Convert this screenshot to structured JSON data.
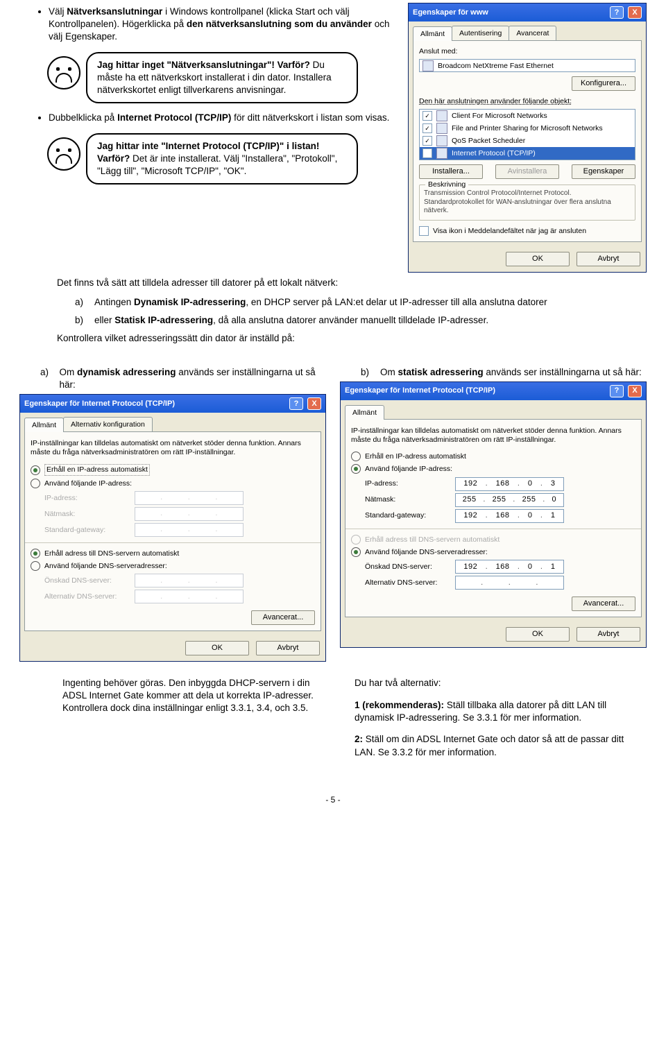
{
  "bullet1": {
    "pre": "Välj ",
    "b": "Nätverksanslutningar",
    "post": " i Windows kontrollpanel (klicka Start och välj Kontrollpanelen). Högerklicka på ",
    "b2": "den nätverksanslutning som du använder",
    "post2": " och välj Egenskaper."
  },
  "callout1": {
    "title": "Jag hittar inget \"Nätverksanslutningar\"! Varför?",
    "body": " Du måste ha ett nätverkskort installerat i din dator. Installera nätverkskortet enligt tillverkarens anvisningar."
  },
  "bullet2": {
    "pre": "Dubbelklicka på ",
    "b": "Internet Protocol (TCP/IP)",
    "post": " för ditt nätverkskort i listan som visas."
  },
  "callout2": {
    "title": "Jag hittar inte \"Internet Protocol (TCP/IP)\" i listan! Varför?",
    "body": " Det är inte installerat. Välj \"Installera\", \"Protokoll\", \"Lägg till\", \"Microsoft TCP/IP\", \"OK\"."
  },
  "win1": {
    "title": "Egenskaper för www",
    "help": "?",
    "close": "X",
    "tabs": [
      "Allmänt",
      "Autentisering",
      "Avancerat"
    ],
    "connect_label": "Anslut med:",
    "adapter": "Broadcom NetXtreme Fast Ethernet",
    "configure": "Konfigurera...",
    "uses_label": "Den här anslutningen använder följande objekt:",
    "items": [
      {
        "chk": true,
        "label": "Client For Microsoft Networks"
      },
      {
        "chk": true,
        "label": "File and Printer Sharing for Microsoft Networks"
      },
      {
        "chk": true,
        "label": "QoS Packet Scheduler"
      },
      {
        "chk": true,
        "label": "Internet Protocol (TCP/IP)",
        "sel": true
      }
    ],
    "btn_install": "Installera...",
    "btn_uninstall": "Avinstallera",
    "btn_props": "Egenskaper",
    "desc_title": "Beskrivning",
    "desc": "Transmission Control Protocol/Internet Protocol. Standardprotokollet för WAN-anslutningar över flera anslutna nätverk.",
    "notify": "Visa ikon i Meddelandefältet när jag är ansluten",
    "ok": "OK",
    "cancel": "Avbryt"
  },
  "midtext": {
    "intro": "Det finns två sätt att tilldela adresser till datorer på ett lokalt nätverk:",
    "a_pre": "Antingen ",
    "a_b": "Dynamisk IP-adressering",
    "a_post": ", en DHCP server på LAN:et delar ut IP-adresser till alla anslutna datorer",
    "b_pre": "eller ",
    "b_b": "Statisk IP-adressering",
    "b_post": ", då alla anslutna datorer använder manuellt tilldelade IP-adresser.",
    "check": "Kontrollera vilket adresseringssätt din dator är inställd på:",
    "dyn_pre": "Om ",
    "dyn_b": "dynamisk adressering",
    "dyn_post": " används ser inställningarna ut så här:",
    "stat_pre": "Om ",
    "stat_b": "statisk adressering",
    "stat_post": " används ser inställningarna ut så här:"
  },
  "tcp": {
    "title": "Egenskaper för Internet Protocol (TCP/IP)",
    "tabs_a": [
      "Allmänt",
      "Alternativ konfiguration"
    ],
    "tabs_b": [
      "Allmänt"
    ],
    "intro": "IP-inställningar kan tilldelas automatiskt om nätverket stöder denna funktion. Annars måste du fråga nätverksadministratören om rätt IP-inställningar.",
    "r_auto_ip": "Erhåll en IP-adress automatiskt",
    "r_man_ip": "Använd följande IP-adress:",
    "f_ip": "IP-adress:",
    "f_mask": "Nätmask:",
    "f_gw": "Standard-gateway:",
    "r_auto_dns": "Erhåll adress till DNS-servern automatiskt",
    "r_man_dns": "Använd följande DNS-serveradresser:",
    "f_dns1": "Önskad DNS-server:",
    "f_dns2": "Alternativ DNS-server:",
    "adv": "Avancerat...",
    "ok": "OK",
    "cancel": "Avbryt"
  },
  "staticvals": {
    "ip": [
      "192",
      "168",
      "0",
      "3"
    ],
    "mask": [
      "255",
      "255",
      "255",
      "0"
    ],
    "gw": [
      "192",
      "168",
      "0",
      "1"
    ],
    "dns1": [
      "192",
      "168",
      "0",
      "1"
    ],
    "dns2": [
      "",
      "",
      "",
      ""
    ]
  },
  "bottom": {
    "left": "Ingenting behöver göras. Den inbyggda DHCP-servern i din ADSL Internet Gate kommer att dela ut korrekta IP-adresser. Kontrollera dock dina inställningar enligt 3.3.1, 3.4, och 3.5.",
    "right_intro": "Du har två alternativ:",
    "r1_b": "1 (rekommenderas):",
    "r1": " Ställ tillbaka alla datorer på ditt LAN till dynamisk IP-adressering. Se 3.3.1 för mer information.",
    "r2_b": "2:",
    "r2": " Ställ om din ADSL Internet Gate och dator så att de passar ditt LAN. Se 3.3.2 för mer information."
  },
  "labels": {
    "a": "a)",
    "b": "b)"
  },
  "pagenum": "- 5 -"
}
